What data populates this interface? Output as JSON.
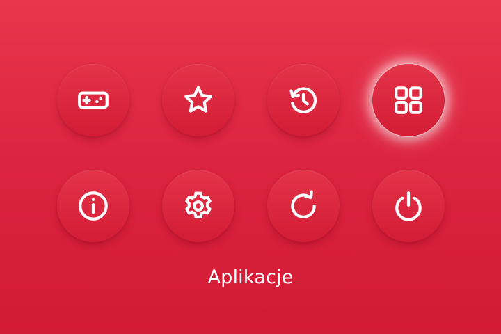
{
  "menu": {
    "items": [
      {
        "icon": "gamepad-icon"
      },
      {
        "icon": "star-icon"
      },
      {
        "icon": "history-icon"
      },
      {
        "icon": "apps-grid-icon"
      },
      {
        "icon": "info-icon"
      },
      {
        "icon": "settings-gear-icon"
      },
      {
        "icon": "refresh-icon"
      },
      {
        "icon": "power-icon"
      }
    ],
    "selected_index": 3,
    "caption": "Aplikacje"
  },
  "colors": {
    "background": "#dd2440",
    "button": "#d91f39",
    "icon": "#ffffff",
    "glow": "#ffffff"
  }
}
